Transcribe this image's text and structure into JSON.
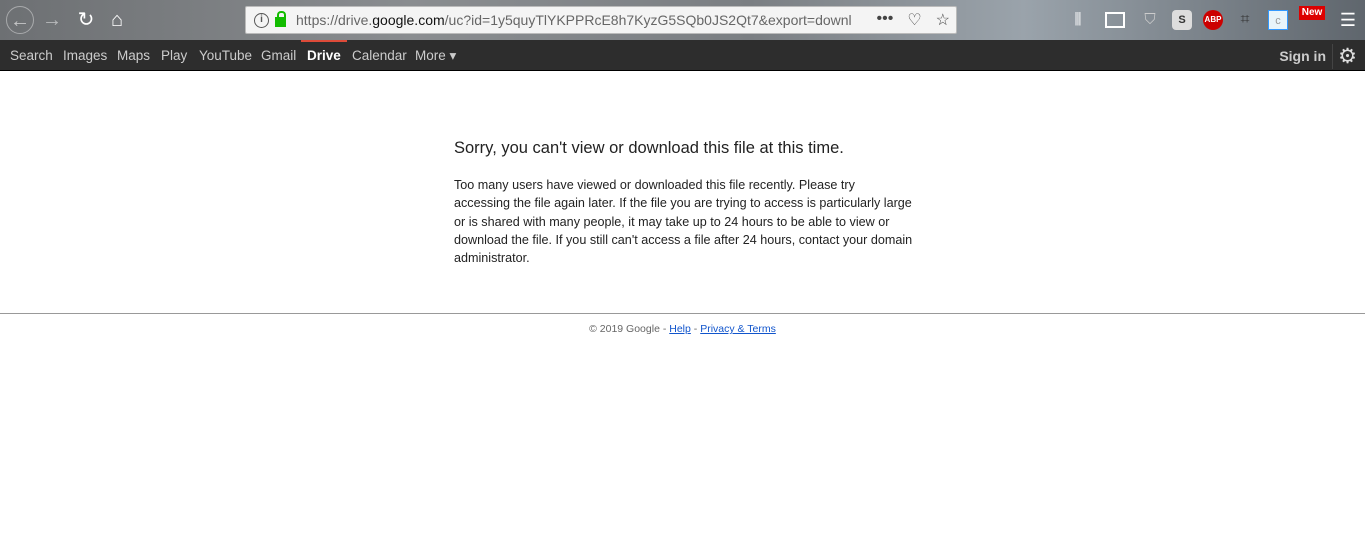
{
  "browser": {
    "url_prefix": "https://drive.",
    "url_domain": "google.com",
    "url_rest": "/uc?id=1y5quyTlYKPPRcE8h7KyzG5SQb0JS2Qt7&export=downl",
    "info_icon": "i",
    "more_icon": "•••",
    "extension_new_badge": "New",
    "extension_abp": "ABP",
    "extension_s": "S"
  },
  "nav": {
    "items": [
      "Search",
      "Images",
      "Maps",
      "Play",
      "YouTube",
      "Gmail",
      "Drive",
      "Calendar",
      "More ▾"
    ],
    "active": "Drive",
    "sign_in": "Sign in"
  },
  "main": {
    "title": "Sorry, you can't view or download this file at this time.",
    "message": "Too many users have viewed or downloaded this file recently. Please try accessing the file again later. If the file you are trying to access is particularly large or is shared with many people, it may take up to 24 hours to be able to view or download the file. If you still can't access a file after 24 hours, contact your domain administrator."
  },
  "footer": {
    "copyright": "© 2019 Google - ",
    "sep": " - ",
    "help": "Help",
    "privacy": "Privacy & Terms"
  },
  "colors": {
    "nav_bg": "#2d2d2d",
    "active_indicator": "#dd4b39",
    "link": "#1155cc",
    "lock": "#12bc00"
  }
}
